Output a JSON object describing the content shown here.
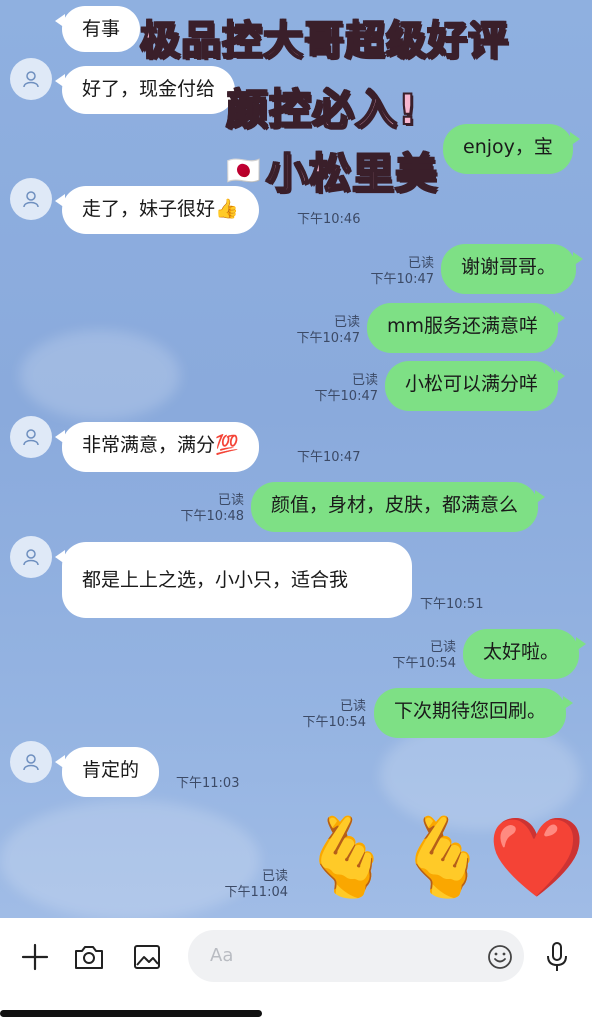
{
  "overlay_text": {
    "line1": "极品控大哥超级好评",
    "line2": "颜控必入!",
    "line3_flag": "🇯🇵",
    "line3": "小松里美"
  },
  "messages": [
    {
      "id": "m1",
      "dir": "in",
      "text": "有事",
      "time": ""
    },
    {
      "id": "m2",
      "dir": "in",
      "text": "好了，现金付给",
      "time": ""
    },
    {
      "id": "m3",
      "dir": "out",
      "text": "enjoy，宝",
      "time": "",
      "read": ""
    },
    {
      "id": "m4",
      "dir": "in",
      "text": "走了，妹子很好👍",
      "time": "下午10:46"
    },
    {
      "id": "m5",
      "dir": "out",
      "text": "谢谢哥哥。",
      "time": "下午10:47",
      "read": "已读"
    },
    {
      "id": "m6",
      "dir": "out",
      "text": "mm服务还满意咩",
      "time": "下午10:47",
      "read": "已读"
    },
    {
      "id": "m7",
      "dir": "out",
      "text": "小松可以满分咩",
      "time": "下午10:47",
      "read": "已读"
    },
    {
      "id": "m8",
      "dir": "in",
      "text": "非常满意，满分💯",
      "time": "下午10:47"
    },
    {
      "id": "m9",
      "dir": "out",
      "text": "颜值，身材，皮肤，都满意么",
      "time": "下午10:48",
      "read": "已读"
    },
    {
      "id": "m10",
      "dir": "in",
      "text": "都是上上之选，小小只，适合我",
      "time": "下午10:51"
    },
    {
      "id": "m11",
      "dir": "out",
      "text": "太好啦。",
      "time": "下午10:54",
      "read": "已读"
    },
    {
      "id": "m12",
      "dir": "out",
      "text": "下次期待您回刷。",
      "time": "下午10:54",
      "read": "已读"
    },
    {
      "id": "m13",
      "dir": "in",
      "text": "肯定的",
      "time": "下午11:03"
    }
  ],
  "sticker": {
    "emojis": [
      "🫰",
      "🫰",
      "❤️"
    ],
    "read": "已读",
    "time": "下午11:04"
  },
  "toolbar": {
    "input_placeholder": "Aa",
    "icons": [
      "plus-icon",
      "camera-icon",
      "image-icon",
      "smiley-icon",
      "microphone-icon"
    ]
  },
  "colors": {
    "background": "#8fb0e0",
    "incoming_bubble": "#ffffff",
    "outgoing_bubble": "#7ee085",
    "overlay_text": "#f7b6cf"
  }
}
